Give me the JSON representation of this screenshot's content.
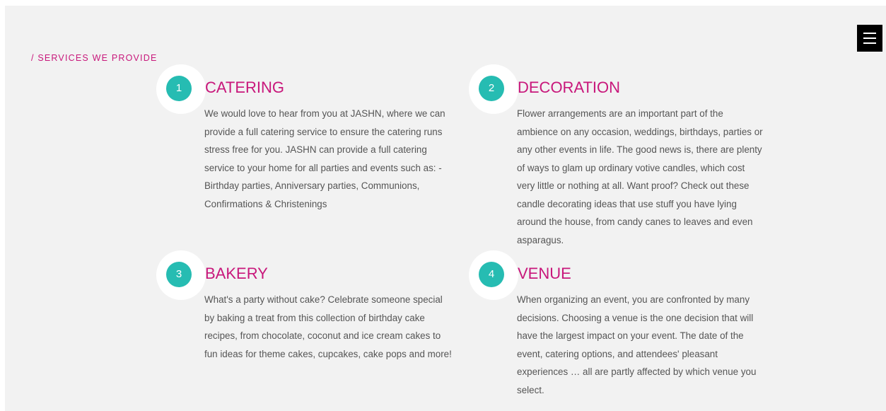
{
  "colors": {
    "accent_pink": "#c8177b",
    "accent_teal": "#26bcb2",
    "text": "#555555",
    "background": "#f2f2f2"
  },
  "header": {
    "menu_icon": "hamburger-menu-icon"
  },
  "section": {
    "label": "/ SERVICES WE PROVIDE"
  },
  "services": [
    {
      "number": "1",
      "title": "CATERING",
      "text": "We would love to hear from you at JASHN, where we can provide a full catering service to ensure the catering runs stress free for you. JASHN can provide a full catering service to your home for all parties and events such as: - Birthday parties, Anniversary parties, Communions, Confirmations & Christenings"
    },
    {
      "number": "2",
      "title": "DECORATION",
      "text": "Flower arrangements are an important part of the ambience on any occasion, weddings, birthdays, parties or any other events in life. The good news is, there are plenty of ways to glam up ordinary votive candles, which cost very little or nothing at all. Want proof? Check out these candle decorating ideas that use stuff you have lying around the house, from candy canes to leaves and even asparagus."
    },
    {
      "number": "3",
      "title": "BAKERY",
      "text": "What's a party without cake? Celebrate someone special by baking a treat from this collection of birthday cake recipes, from chocolate, coconut and ice cream cakes to fun ideas for theme cakes, cupcakes, cake pops and more!"
    },
    {
      "number": "4",
      "title": "VENUE",
      "text": "When organizing an event, you are confronted by many decisions. Choosing a venue is the one decision that will have the largest impact on your event. The date of the event, catering options, and attendees' pleasant experiences … all are partly affected by which venue you select."
    }
  ]
}
